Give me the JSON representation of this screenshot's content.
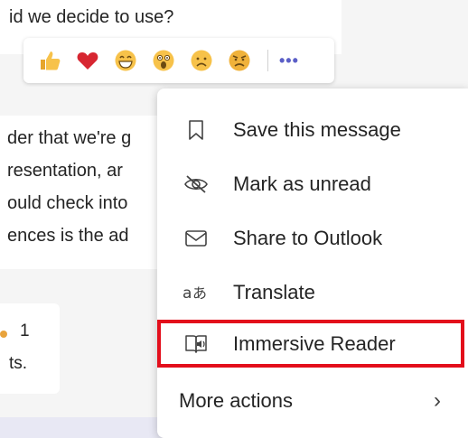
{
  "background": {
    "top_message": "id we decide to use?",
    "mid_lines": [
      "der that we're g",
      "resentation, ar",
      "ould check into",
      "ences is the ad"
    ],
    "card_lines": [
      "1",
      "ts."
    ]
  },
  "reactions": {
    "items": [
      {
        "name": "like",
        "icon": "thumbs-up-icon"
      },
      {
        "name": "heart",
        "icon": "heart-icon"
      },
      {
        "name": "laugh",
        "icon": "laugh-icon"
      },
      {
        "name": "surprised",
        "icon": "surprised-icon"
      },
      {
        "name": "sad",
        "icon": "sad-icon"
      },
      {
        "name": "angry",
        "icon": "angry-icon"
      }
    ],
    "more_label": "•••"
  },
  "menu": {
    "items": [
      {
        "label": "Save this message",
        "icon": "bookmark-icon"
      },
      {
        "label": "Mark as unread",
        "icon": "unread-eye-icon"
      },
      {
        "label": "Share to Outlook",
        "icon": "mail-icon"
      },
      {
        "label": "Translate",
        "icon": "translate-icon"
      },
      {
        "label": "Immersive Reader",
        "icon": "immersive-reader-icon"
      },
      {
        "label": "More actions",
        "icon": "chevron-right-icon"
      }
    ],
    "chevron": "›"
  },
  "colors": {
    "accent": "#5b5fc7",
    "highlight": "#e30e1b",
    "emoji_yellow": "#f7c24a",
    "heart": "#d72631"
  }
}
